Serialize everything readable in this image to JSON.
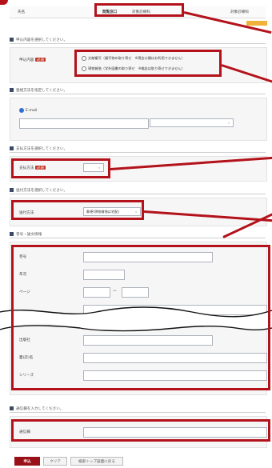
{
  "top_row": {
    "name_label": "氏名",
    "tab1": "閲覧窓口",
    "tab2": "対象診療科",
    "tab3": "対象診療科"
  },
  "section1": {
    "heading": "申込内容を選択してください。",
    "label": "申込内容",
    "required": "必須",
    "options": [
      "文献複写（複写物の取り寄せ　※現金公開はお利用できません）",
      "現物貸借（学外図書の取り寄せ　※雑誌は取り寄せできません）"
    ]
  },
  "section2": {
    "heading": "連絡方法を指定してください。",
    "email_label": "E-mail"
  },
  "section3": {
    "heading": "支払方法を選択してください。",
    "label": "支払方法",
    "required": "必須"
  },
  "section4": {
    "heading": "送付方法を選択してください。",
    "label": "送付方法",
    "value": "郵便(現物貸借は宅配)"
  },
  "section5": {
    "heading": "巻号・論文情報",
    "fields": {
      "volume": "巻号",
      "year": "年次",
      "pages": "ページ",
      "publisher": "出版社",
      "series_name": "叢(誌)名",
      "series": "シリーズ"
    },
    "range_sep": "〜"
  },
  "section6": {
    "heading": "通信欄を入力してください。",
    "label": "通信欄"
  },
  "buttons": {
    "submit": "申込",
    "clear": "クリア",
    "back": "検索トップ画面に戻る"
  },
  "colors": {
    "accent_red": "#b3121b",
    "submit_bg": "#9a1018",
    "section_icon": "#3b4a66"
  }
}
